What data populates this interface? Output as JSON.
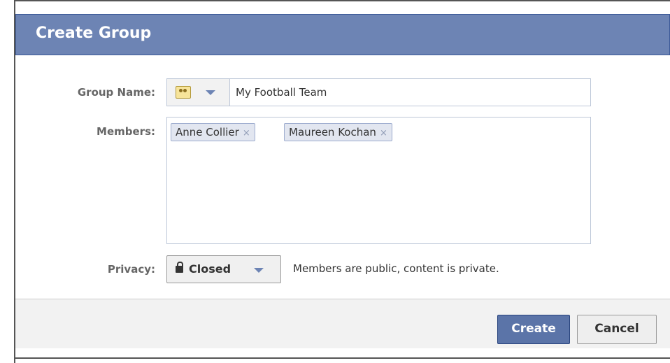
{
  "dialog": {
    "title": "Create Group",
    "group_name_label": "Group Name:",
    "group_name_value": "My Football Team",
    "members_label": "Members:",
    "members": [
      {
        "name": "Anne Collier",
        "remove": "×"
      },
      {
        "name": "Maureen Kochan",
        "remove": "×"
      }
    ],
    "privacy_label": "Privacy:",
    "privacy_value": "Closed",
    "privacy_description": "Members are public, content is private.",
    "create_label": "Create",
    "cancel_label": "Cancel"
  },
  "icons": {
    "group_icon": "group-icon",
    "dropdown": "chevron-down-icon",
    "lock": "lock-icon",
    "remove": "close-icon"
  },
  "colors": {
    "header_bg": "#6d84b4",
    "primary_button": "#5b74a8",
    "token_bg": "#e2e6f0",
    "input_border": "#bdc7d8"
  }
}
